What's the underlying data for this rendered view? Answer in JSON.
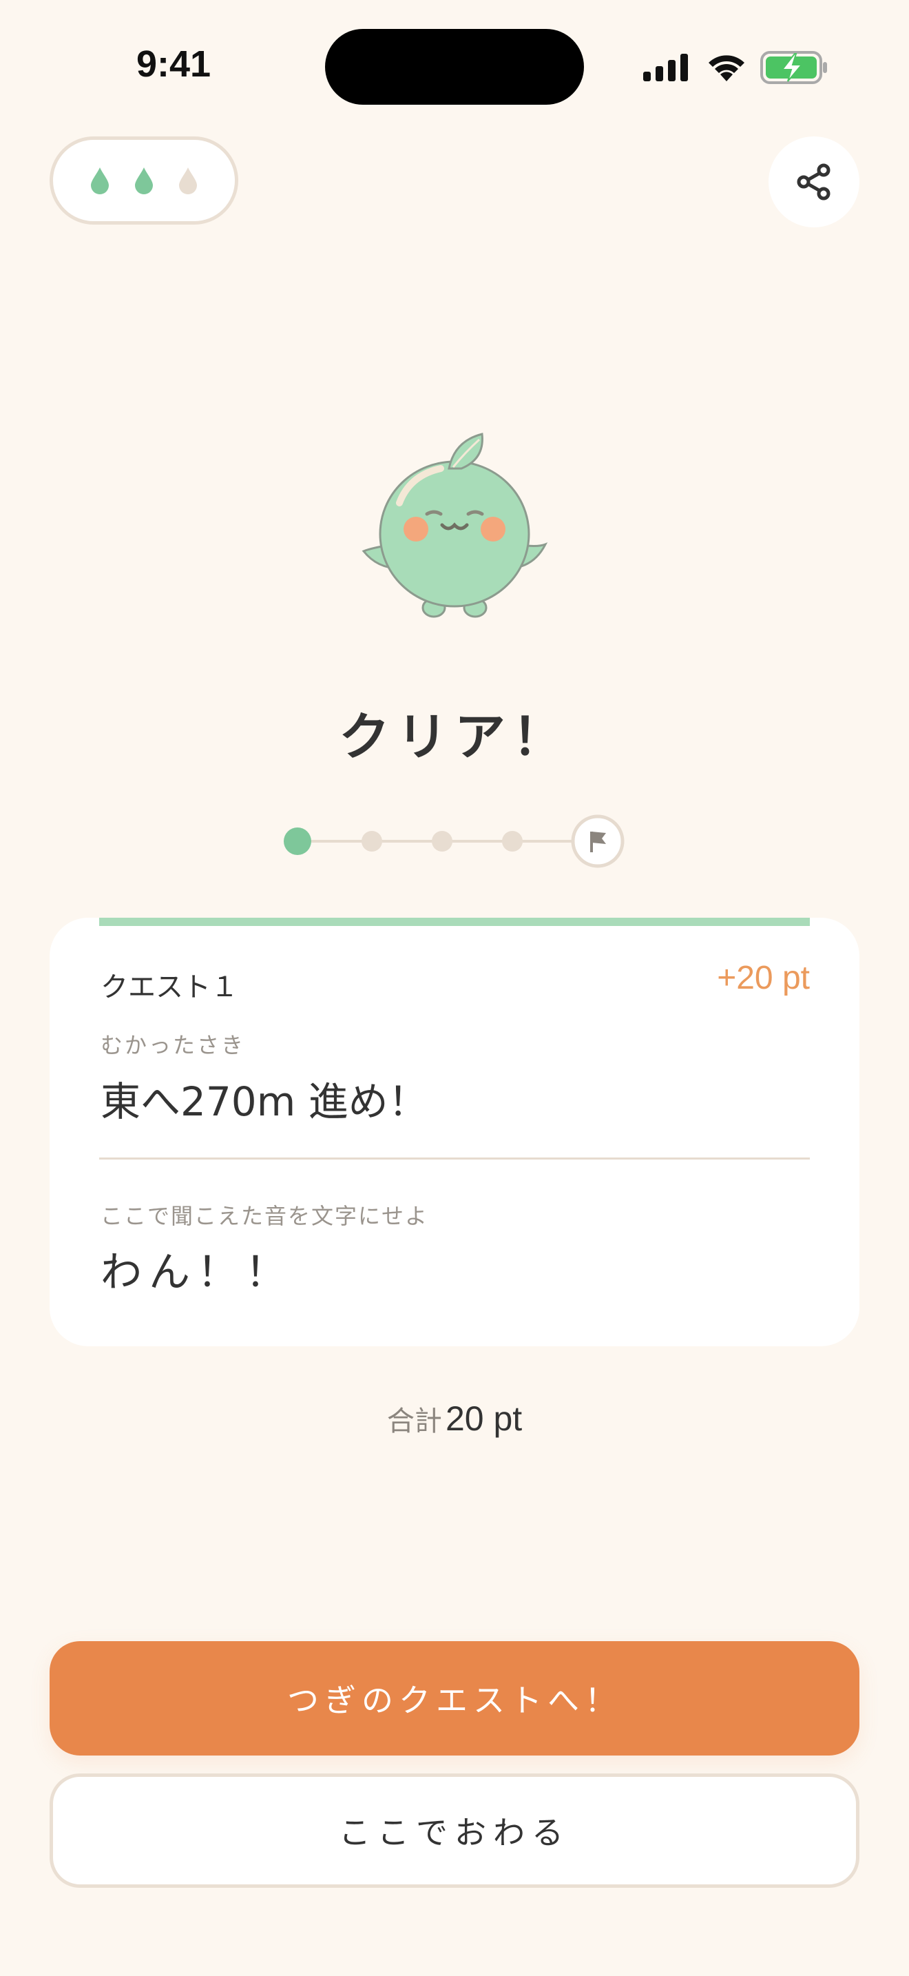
{
  "status_bar": {
    "time": "9:41"
  },
  "lives": {
    "filled": 2,
    "total": 3,
    "filled_color": "#7ec79a",
    "empty_color": "#e8ddd1",
    "icon": "drop-icon"
  },
  "share": {
    "icon": "share-icon"
  },
  "title": "クリア！",
  "progress": {
    "completed": 1,
    "total_steps": 4,
    "goal_icon": "flag-icon"
  },
  "quest": {
    "label": "クエスト１",
    "points": "+20 pt",
    "destination_caption": "むかったさき",
    "destination": "東へ270m 進め！",
    "sound_caption": "ここで聞こえた音を文字にせよ",
    "sound_answer": "わん！！"
  },
  "total": {
    "label": "合計",
    "value": "20 pt"
  },
  "buttons": {
    "next": "つぎのクエストへ！",
    "end": "ここでおわる"
  },
  "colors": {
    "background": "#fdf7f0",
    "accent_orange": "#e8874b",
    "accent_green": "#7ec79a"
  }
}
